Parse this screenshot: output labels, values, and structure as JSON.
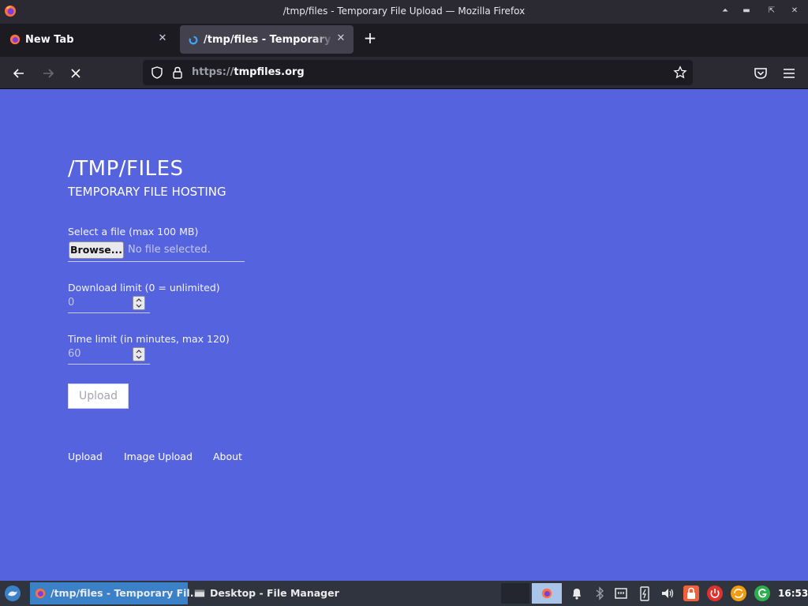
{
  "window": {
    "title": "/tmp/files - Temporary File Upload — Mozilla Firefox"
  },
  "tabs": [
    {
      "label": "New Tab"
    },
    {
      "label": "/tmp/files - Temporary File Upload"
    }
  ],
  "nav": {
    "url_scheme": "https://",
    "url_host": "tmpfiles.org"
  },
  "page": {
    "title": "/TMP/FILES",
    "subtitle": "TEMPORARY FILE HOSTING",
    "file_label": "Select a file (max 100 MB)",
    "browse_label": "Browse...",
    "file_status": "No file selected.",
    "download_limit_label": "Download limit (0 = unlimited)",
    "download_limit_value": "0",
    "time_limit_label": "Time limit (in minutes, max 120)",
    "time_limit_value": "60",
    "upload_button": "Upload",
    "footer_links": [
      "Upload",
      "Image Upload",
      "About"
    ]
  },
  "taskbar": {
    "tasks": [
      {
        "label": "/tmp/files - Temporary Fil..."
      },
      {
        "label": "Desktop - File Manager"
      }
    ],
    "clock": "16:53"
  },
  "colors": {
    "page_background": "#5663de",
    "browser_chrome": "#2b2a33",
    "taskbar": "#2f343f",
    "active_task": "#3b81c8"
  }
}
